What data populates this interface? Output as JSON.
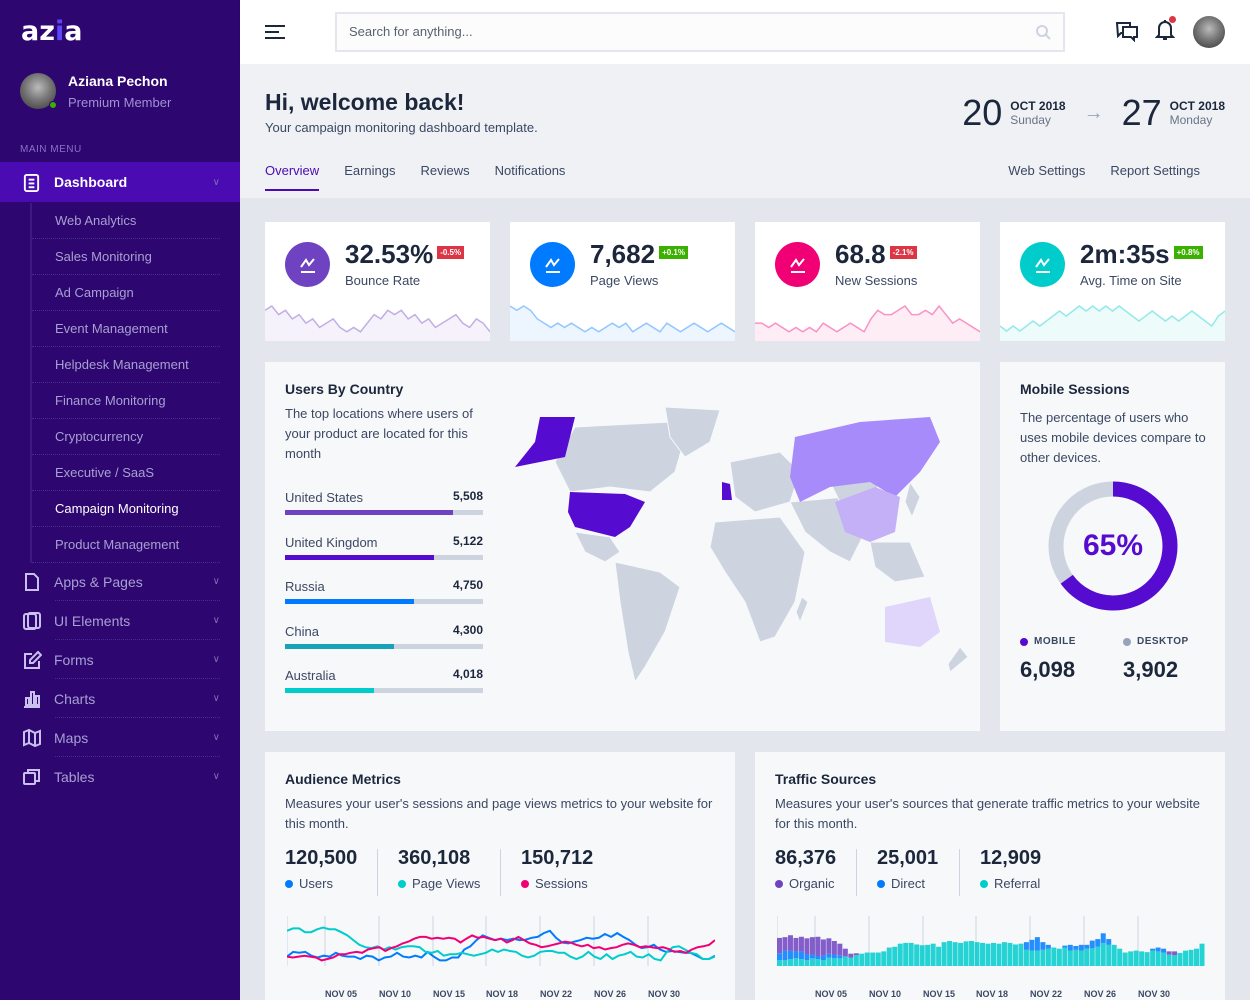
{
  "app": {
    "logo_text_a": "az",
    "logo_text_i": "i",
    "logo_text_b": "a"
  },
  "profile": {
    "name": "Aziana Pechon",
    "role": "Premium Member",
    "status": "online"
  },
  "sidebar": {
    "section_label": "MAIN MENU",
    "dashboard_label": "Dashboard",
    "dashboard_items": [
      {
        "label": "Web Analytics"
      },
      {
        "label": "Sales Monitoring"
      },
      {
        "label": "Ad Campaign"
      },
      {
        "label": "Event Management"
      },
      {
        "label": "Helpdesk Management"
      },
      {
        "label": "Finance Monitoring"
      },
      {
        "label": "Cryptocurrency"
      },
      {
        "label": "Executive / SaaS"
      },
      {
        "label": "Campaign Monitoring",
        "active": true
      },
      {
        "label": "Product Management"
      }
    ],
    "items": [
      {
        "label": "Apps & Pages",
        "icon": "file-icon"
      },
      {
        "label": "UI Elements",
        "icon": "layers-icon"
      },
      {
        "label": "Forms",
        "icon": "edit-icon"
      },
      {
        "label": "Charts",
        "icon": "bar-chart-icon"
      },
      {
        "label": "Maps",
        "icon": "map-icon"
      },
      {
        "label": "Tables",
        "icon": "copy-icon"
      }
    ]
  },
  "topbar": {
    "search_placeholder": "Search for anything...",
    "notification_dot": true
  },
  "header": {
    "title": "Hi, welcome back!",
    "subtitle": "Your campaign monitoring dashboard template.",
    "date_from": {
      "day": "20",
      "month": "OCT 2018",
      "weekday": "Sunday"
    },
    "date_to": {
      "day": "27",
      "month": "OCT 2018",
      "weekday": "Monday"
    },
    "tabs": [
      {
        "label": "Overview",
        "active": true
      },
      {
        "label": "Earnings"
      },
      {
        "label": "Reviews"
      },
      {
        "label": "Notifications"
      }
    ],
    "right_tabs": [
      {
        "label": "Web Settings"
      },
      {
        "label": "Report Settings"
      }
    ]
  },
  "stats": [
    {
      "value": "32.53%",
      "change": "-0.5%",
      "label": "Bounce Rate",
      "color": "#6f42c1",
      "badge_color": "#dc3545",
      "spark": [
        6,
        7,
        5,
        6,
        4,
        5,
        3,
        4,
        2,
        3,
        4,
        2,
        1,
        2,
        1,
        3,
        5,
        4,
        6,
        5,
        6,
        4,
        5,
        3,
        4,
        2,
        3,
        4,
        5,
        3,
        2,
        4,
        3,
        1
      ]
    },
    {
      "value": "7,682",
      "change": "+0.1%",
      "label": "Page Views",
      "color": "#007bff",
      "badge_color": "#3bb001",
      "spark": [
        7,
        6,
        7,
        6,
        4,
        3,
        2,
        3,
        2,
        3,
        2,
        1,
        2,
        1,
        2,
        3,
        2,
        3,
        1,
        2,
        3,
        2,
        1,
        3,
        2,
        1,
        2,
        3,
        2,
        1,
        2,
        3,
        2,
        1
      ]
    },
    {
      "value": "68.8",
      "change": "-2.1%",
      "label": "New Sessions",
      "color": "#f10075",
      "badge_color": "#dc3545",
      "spark": [
        3,
        3,
        2,
        3,
        2,
        1,
        2,
        1,
        2,
        1,
        3,
        2,
        1,
        2,
        3,
        2,
        1,
        4,
        6,
        5,
        5,
        6,
        7,
        5,
        5,
        6,
        5,
        7,
        5,
        3,
        4,
        3,
        2,
        1
      ]
    },
    {
      "value": "2m:35s",
      "change": "+0.8%",
      "label": "Avg. Time on Site",
      "color": "#00cccc",
      "badge_color": "#3bb001",
      "spark": [
        2,
        1,
        2,
        1,
        2,
        3,
        2,
        3,
        4,
        5,
        4,
        5,
        6,
        5,
        6,
        5,
        6,
        5,
        6,
        5,
        4,
        3,
        4,
        5,
        4,
        3,
        4,
        3,
        4,
        5,
        4,
        3,
        2,
        4,
        5
      ]
    }
  ],
  "users_by_country": {
    "title": "Users By Country",
    "description": "The top locations where users of your product are located for this month",
    "rows": [
      {
        "country": "United States",
        "value": "5,508",
        "fill": 0.85,
        "color": "#6f42c1"
      },
      {
        "country": "United Kingdom",
        "value": "5,122",
        "fill": 0.75,
        "color": "#560bd0"
      },
      {
        "country": "Russia",
        "value": "4,750",
        "fill": 0.65,
        "color": "#007bff"
      },
      {
        "country": "China",
        "value": "4,300",
        "fill": 0.55,
        "color": "#17a2b8"
      },
      {
        "country": "Australia",
        "value": "4,018",
        "fill": 0.45,
        "color": "#00cccc"
      }
    ],
    "map_highlights": [
      {
        "region": "United States",
        "color": "#560bd0"
      },
      {
        "region": "United Kingdom",
        "color": "#560bd0"
      },
      {
        "region": "Russia",
        "color": "#a78bfa"
      },
      {
        "region": "China",
        "color": "#c4b0f7"
      },
      {
        "region": "Australia",
        "color": "#e0d5fa"
      }
    ]
  },
  "mobile_sessions": {
    "title": "Mobile Sessions",
    "description": "The percentage of users who uses mobile devices compare to other devices.",
    "percent_label": "65%",
    "percent": 65,
    "legend": [
      {
        "label": "MOBILE",
        "value": "6,098",
        "color": "#560bd0"
      },
      {
        "label": "DESKTOP",
        "value": "3,902",
        "color": "#97a3b9"
      }
    ]
  },
  "audience": {
    "title": "Audience Metrics",
    "description": "Measures your user's sessions and page views metrics to your website for this month.",
    "metrics": [
      {
        "value": "120,500",
        "label": "Users",
        "color": "#007bff"
      },
      {
        "value": "360,108",
        "label": "Page Views",
        "color": "#00cccc"
      },
      {
        "value": "150,712",
        "label": "Sessions",
        "color": "#f10075"
      }
    ]
  },
  "traffic": {
    "title": "Traffic Sources",
    "description": "Measures your user's sources that generate traffic metrics to your website for this month.",
    "metrics": [
      {
        "value": "86,376",
        "label": "Organic",
        "color": "#6f42c1"
      },
      {
        "value": "25,001",
        "label": "Direct",
        "color": "#007bff"
      },
      {
        "value": "12,909",
        "label": "Referral",
        "color": "#00cccc"
      }
    ]
  },
  "chart_data": [
    {
      "type": "line",
      "title": "Audience Metrics",
      "x_ticks": [
        "NOV 05",
        "NOV 10",
        "NOV 15",
        "NOV 18",
        "NOV 22",
        "NOV 26",
        "NOV 30"
      ],
      "ylim": [
        0,
        100
      ],
      "grid": "vertical",
      "series": [
        {
          "name": "Users",
          "color": "#007bff",
          "values": [
            20,
            30,
            28,
            30,
            22,
            18,
            22,
            20,
            28,
            22,
            20,
            20,
            15,
            22,
            20,
            12,
            18,
            20,
            28,
            20,
            18,
            22,
            18,
            30,
            20,
            12,
            12,
            18,
            18,
            35,
            42,
            55,
            65,
            60,
            55,
            58,
            55,
            58,
            55,
            56,
            60,
            62,
            70,
            75,
            60,
            50,
            48,
            52,
            55,
            60,
            58,
            60,
            68,
            62,
            70,
            62,
            55,
            45,
            38,
            40,
            45,
            35,
            30,
            32,
            30,
            28,
            28,
            22,
            15,
            15,
            22
          ]
        },
        {
          "name": "Page Views",
          "color": "#00cccc",
          "values": [
            75,
            80,
            80,
            72,
            72,
            78,
            82,
            78,
            78,
            72,
            65,
            55,
            45,
            40,
            38,
            42,
            35,
            40,
            35,
            40,
            42,
            42,
            40,
            30,
            28,
            32,
            22,
            25,
            25,
            28,
            25,
            22,
            25,
            28,
            35,
            30,
            35,
            32,
            30,
            22,
            18,
            22,
            30,
            32,
            32,
            28,
            28,
            20,
            15,
            20,
            30,
            20,
            15,
            25,
            15,
            22,
            25,
            30,
            20,
            18,
            25,
            15,
            12,
            30,
            40,
            42,
            35,
            28,
            25,
            15,
            15,
            20
          ]
        },
        {
          "name": "Sessions",
          "color": "#f10075",
          "values": [
            20,
            18,
            20,
            22,
            20,
            18,
            12,
            15,
            18,
            25,
            25,
            28,
            30,
            28,
            35,
            38,
            40,
            32,
            38,
            42,
            48,
            52,
            58,
            62,
            62,
            58,
            60,
            58,
            60,
            58,
            50,
            58,
            65,
            60,
            62,
            58,
            55,
            58,
            50,
            55,
            62,
            55,
            48,
            45,
            40,
            42,
            45,
            48,
            52,
            50,
            45,
            42,
            45,
            38,
            40,
            35,
            38,
            40,
            45,
            48,
            45,
            40,
            42,
            40,
            38,
            40,
            36,
            30,
            32,
            28,
            35,
            40,
            42,
            45,
            55
          ]
        }
      ]
    },
    {
      "type": "bar",
      "stacked": true,
      "title": "Traffic Sources",
      "x_ticks": [
        "NOV 05",
        "NOV 10",
        "NOV 15",
        "NOV 18",
        "NOV 22",
        "NOV 26",
        "NOV 30"
      ],
      "ylim": [
        0,
        100
      ],
      "grid": "vertical",
      "series": [
        {
          "name": "Referral",
          "color": "#00cccc",
          "values": [
            15,
            15,
            18,
            20,
            18,
            15,
            20,
            18,
            15,
            22,
            20,
            20,
            25,
            22,
            28,
            32,
            35,
            35,
            35,
            38,
            48,
            50,
            58,
            60,
            60,
            56,
            54,
            55,
            58,
            50,
            62,
            65,
            62,
            60,
            64,
            65,
            62,
            60,
            58,
            60,
            58,
            62,
            60,
            56,
            58,
            42,
            40,
            40,
            42,
            45,
            48,
            45,
            48,
            40,
            42,
            40,
            45,
            46,
            50,
            60,
            55,
            55,
            45,
            35,
            38,
            40,
            38,
            36,
            40,
            38,
            35,
            30,
            28,
            34,
            40,
            42,
            45,
            58
          ]
        },
        {
          "name": "Direct",
          "color": "#007bff",
          "values": [
            18,
            25,
            22,
            18,
            20,
            15,
            10,
            8,
            12,
            10,
            10,
            8,
            0,
            0,
            0,
            0,
            0,
            0,
            0,
            0,
            0,
            0,
            0,
            0,
            0,
            0,
            0,
            0,
            0,
            0,
            0,
            0,
            0,
            0,
            0,
            0,
            0,
            0,
            0,
            0,
            0,
            0,
            0,
            0,
            0,
            20,
            28,
            35,
            20,
            10,
            0,
            0,
            5,
            15,
            10,
            15,
            10,
            20,
            20,
            25,
            15,
            0,
            0,
            0,
            0,
            0,
            0,
            0,
            5,
            10,
            10,
            0,
            0,
            0,
            0,
            0,
            0,
            0
          ]
        },
        {
          "name": "Organic",
          "color": "#6f42c1",
          "values": [
            40,
            35,
            40,
            35,
            38,
            42,
            45,
            50,
            42,
            40,
            35,
            30,
            20,
            10,
            5,
            0,
            0,
            0,
            0,
            0,
            0,
            0,
            0,
            0,
            0,
            0,
            0,
            0,
            0,
            0,
            0,
            0,
            0,
            0,
            0,
            0,
            0,
            0,
            0,
            0,
            0,
            0,
            0,
            0,
            0,
            0,
            0,
            0,
            0,
            0,
            0,
            0,
            0,
            0,
            0,
            0,
            0,
            0,
            0,
            0,
            0,
            0,
            0,
            0,
            0,
            0,
            0,
            0,
            0,
            0,
            0,
            8,
            10,
            0,
            0,
            0,
            0,
            0
          ]
        }
      ]
    }
  ]
}
